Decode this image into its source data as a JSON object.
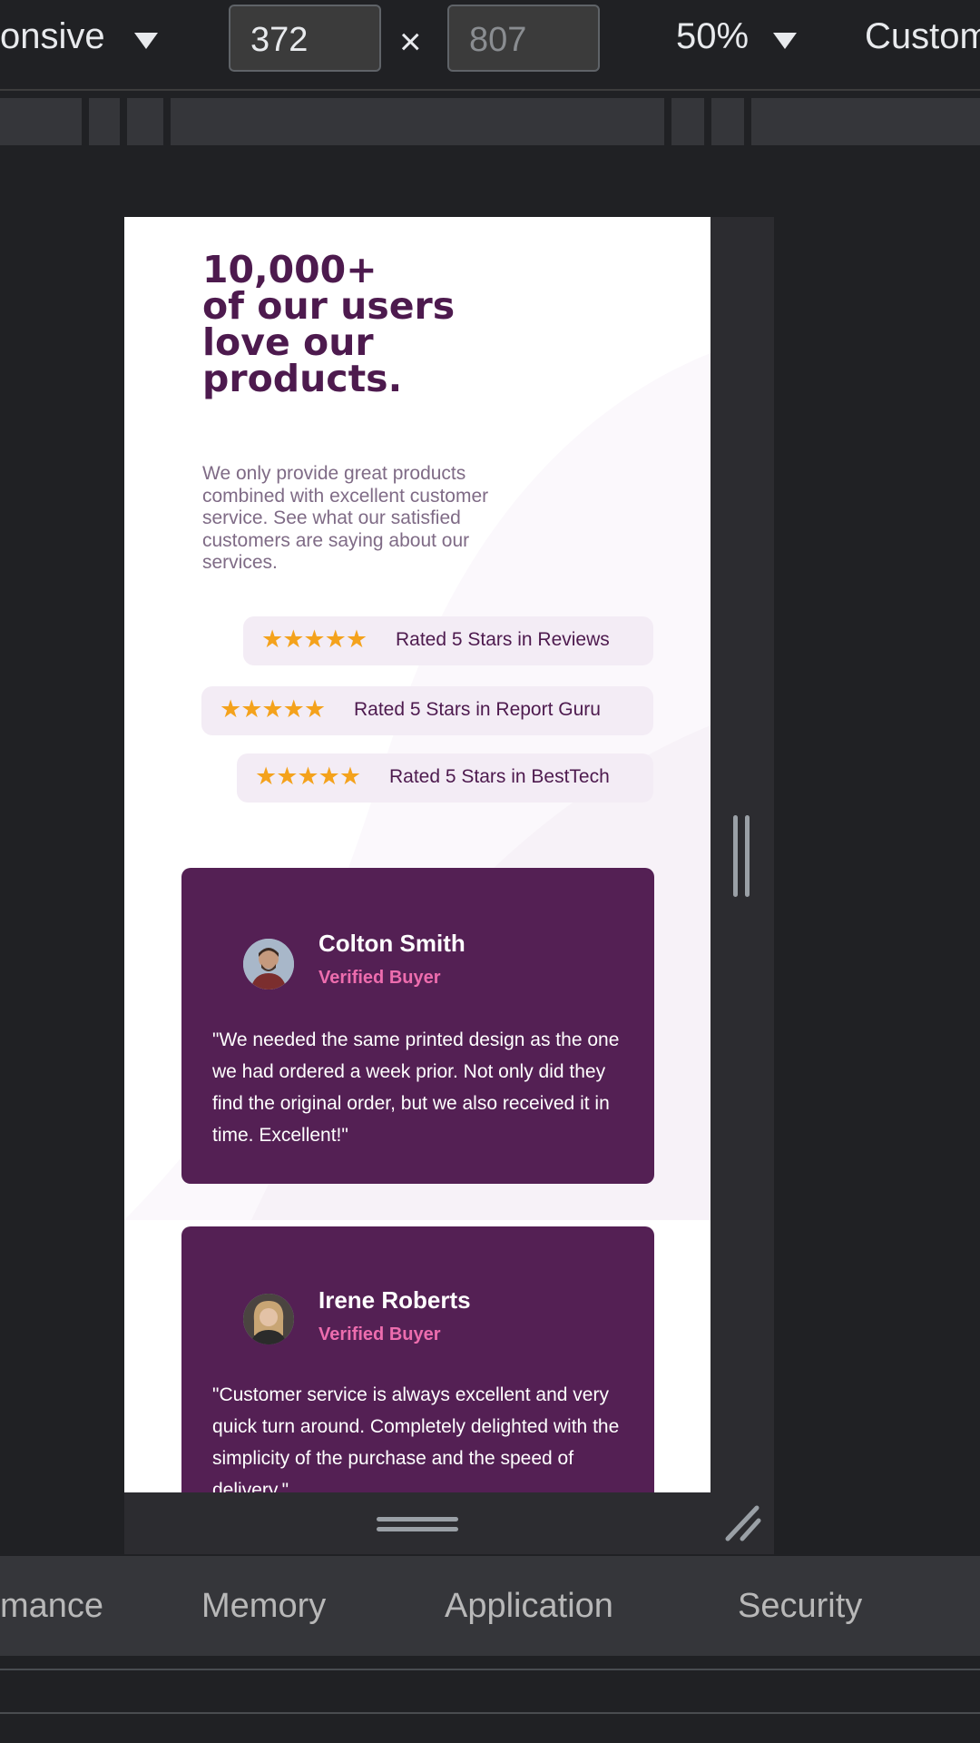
{
  "toolbar": {
    "device_mode": "onsive",
    "width_value": "372",
    "times": "×",
    "height_placeholder": "807",
    "zoom": "50%",
    "throttle": "Custom"
  },
  "page": {
    "heading_count": "10,000+",
    "heading_rest": "of our users love our products.",
    "lead": "We only provide great products combined with excellent customer service. See what our satisfied customers are saying about our services.",
    "stars": "★★★★★",
    "ratings": [
      {
        "label": "Rated 5 Stars in Reviews"
      },
      {
        "label": "Rated 5 Stars in Report Guru"
      },
      {
        "label": "Rated 5 Stars in BestTech"
      }
    ],
    "testimonials": [
      {
        "name": "Colton Smith",
        "badge": "Verified Buyer",
        "quote": "\"We needed the same printed design as the one we had ordered a week prior. Not only did they find the original order, but we also received it in time. Excellent!\""
      },
      {
        "name": "Irene Roberts",
        "badge": "Verified Buyer",
        "quote": "\"Customer service is always excellent and very quick turn around. Completely delighted with the simplicity of the purchase and the speed of delivery.\""
      }
    ],
    "colors": {
      "heading": "#4d1a4e",
      "card": "#542054",
      "star": "#f4a21c",
      "badge": "#ed6dae"
    }
  },
  "devtools": {
    "tabs": [
      "mance",
      "Memory",
      "Application",
      "Security"
    ]
  }
}
